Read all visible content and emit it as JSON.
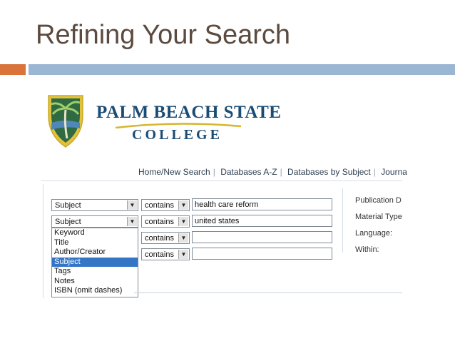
{
  "slide": {
    "title": "Refining Your Search"
  },
  "logo": {
    "line1": "PALM BEACH STATE",
    "line2": "COLLEGE"
  },
  "nav": {
    "items": [
      "Home/New Search",
      "Databases A-Z",
      "Databases by Subject",
      "Journa"
    ]
  },
  "rows": [
    {
      "field": "Subject",
      "operator": "contains",
      "term": "health care reform"
    },
    {
      "field": "Subject",
      "operator": "contains",
      "term": "united states"
    },
    {
      "field": "",
      "operator": "contains",
      "term": ""
    },
    {
      "field": "",
      "operator": "contains",
      "term": ""
    }
  ],
  "field_options": [
    "Keyword",
    "Title",
    "Author/Creator",
    "Subject",
    "Tags",
    "Notes",
    "ISBN (omit dashes)"
  ],
  "selected_option": "Subject",
  "limits": [
    "Publication D",
    "Material Type",
    "Language:",
    "Within:"
  ],
  "colors": {
    "title": "#5b4a3f",
    "accent_orange": "#d9733a",
    "accent_blue": "#9bb6d3",
    "logo_blue": "#1b4c74",
    "highlight": "#3575c6"
  }
}
